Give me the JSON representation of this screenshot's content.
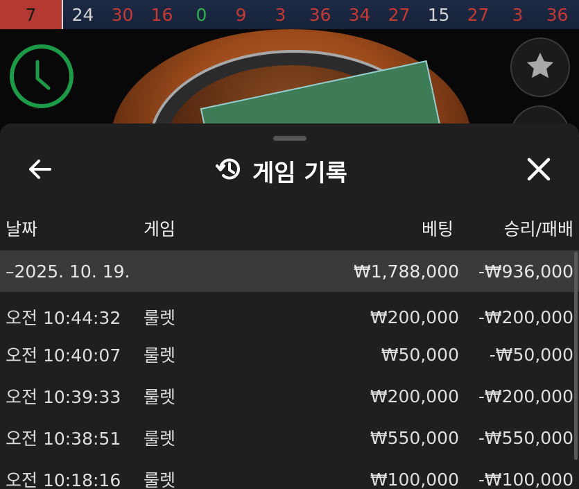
{
  "results_strip": [
    {
      "value": "7",
      "color": "red"
    },
    {
      "value": "24",
      "color": "black"
    },
    {
      "value": "30",
      "color": "red"
    },
    {
      "value": "16",
      "color": "red"
    },
    {
      "value": "0",
      "color": "green"
    },
    {
      "value": "9",
      "color": "red"
    },
    {
      "value": "3",
      "color": "red"
    },
    {
      "value": "36",
      "color": "red"
    },
    {
      "value": "34",
      "color": "red"
    },
    {
      "value": "27",
      "color": "red"
    },
    {
      "value": "15",
      "color": "black"
    },
    {
      "value": "27",
      "color": "red"
    },
    {
      "value": "3",
      "color": "red"
    },
    {
      "value": "36",
      "color": "red"
    }
  ],
  "side_buttons": {
    "favorite_icon": "star-icon",
    "timer_icon": "clock-icon"
  },
  "history": {
    "title": "게임 기록",
    "title_icon": "history-icon",
    "back_icon": "arrow-left-icon",
    "close_icon": "close-icon",
    "columns": {
      "date": "날짜",
      "game": "게임",
      "bet": "베팅",
      "result": "승리/패배"
    },
    "date_group": {
      "label": "–2025. 10. 19.",
      "bet_total": "₩1,788,000",
      "result_total": "-₩936,000"
    },
    "rows": [
      {
        "time": "오전 10:44:32",
        "game": "룰렛",
        "bet": "₩200,000",
        "result": "-₩200,000"
      },
      {
        "time": "오전 10:40:07",
        "game": "룰렛",
        "bet": "₩50,000",
        "result": "-₩50,000"
      },
      {
        "time": "오전 10:39:33",
        "game": "룰렛",
        "bet": "₩200,000",
        "result": "-₩200,000"
      },
      {
        "time": "오전 10:38:51",
        "game": "룰렛",
        "bet": "₩550,000",
        "result": "-₩550,000"
      },
      {
        "time": "오전 10:18:16",
        "game": "룰렛",
        "bet": "₩100,000",
        "result": "-₩100,000"
      }
    ]
  },
  "colors": {
    "red": "#c23a34",
    "black": "#d2d2d2",
    "green": "#2fb04e",
    "timer_ring": "#1d9a47"
  }
}
